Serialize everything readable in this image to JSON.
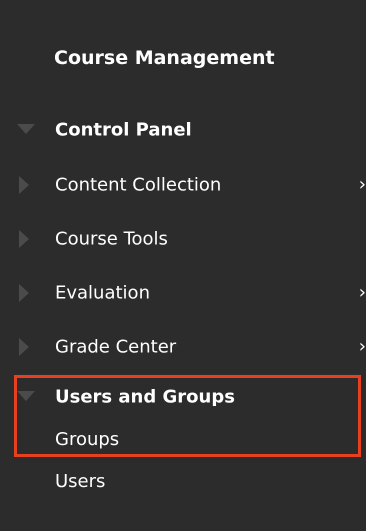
{
  "panel": {
    "title": "Course Management",
    "items": [
      {
        "label": "Control Panel",
        "expanded": true,
        "bold": true,
        "has_submenu": false,
        "arrow_icon": "triangle-down-icon"
      },
      {
        "label": "Content Collection",
        "expanded": false,
        "bold": false,
        "has_submenu": true,
        "submenu_chevron": "›",
        "arrow_icon": "triangle-right-icon"
      },
      {
        "label": "Course Tools",
        "expanded": false,
        "bold": false,
        "has_submenu": false,
        "arrow_icon": "triangle-right-icon"
      },
      {
        "label": "Evaluation",
        "expanded": false,
        "bold": false,
        "has_submenu": true,
        "submenu_chevron": "›",
        "arrow_icon": "triangle-right-icon"
      },
      {
        "label": "Grade Center",
        "expanded": false,
        "bold": false,
        "has_submenu": true,
        "submenu_chevron": "›",
        "arrow_icon": "triangle-right-icon"
      },
      {
        "label": "Users and Groups",
        "expanded": true,
        "bold": true,
        "has_submenu": false,
        "arrow_icon": "triangle-down-icon"
      }
    ],
    "users_and_groups_children": [
      {
        "label": "Groups"
      },
      {
        "label": "Users"
      }
    ]
  },
  "colors": {
    "panel_background": "#2c2c2c",
    "text": "#ffffff",
    "arrow": "#4b4b4b",
    "highlight_border": "#e8401f"
  }
}
